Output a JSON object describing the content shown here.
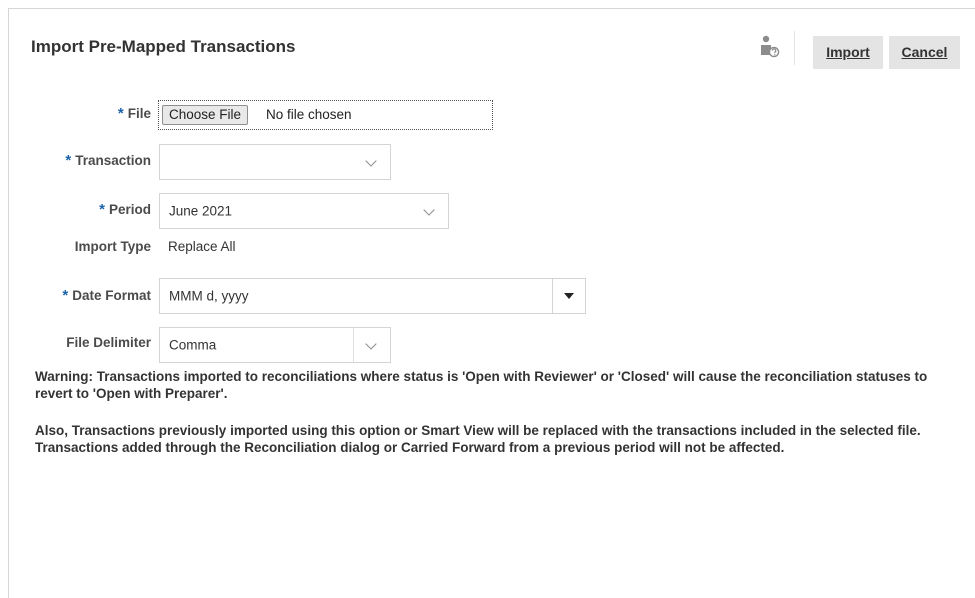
{
  "dialog": {
    "title": "Import Pre-Mapped Transactions",
    "help_icon": "user-help-icon",
    "import_label": "Import",
    "cancel_label": "Cancel"
  },
  "form": {
    "required_marker": "*",
    "file": {
      "label": "File",
      "button_label": "Choose File",
      "status": "No file chosen"
    },
    "transaction": {
      "label": "Transaction",
      "value": ""
    },
    "period": {
      "label": "Period",
      "value": "June 2021"
    },
    "import_type": {
      "label": "Import Type",
      "value": "Replace All"
    },
    "date_format": {
      "label": "Date Format",
      "value": "MMM d, yyyy"
    },
    "file_delimiter": {
      "label": "File Delimiter",
      "value": "Comma"
    }
  },
  "messages": {
    "warning": "Warning: Transactions imported to reconciliations where status is 'Open with Reviewer' or 'Closed' will cause the reconciliation statuses to revert to 'Open with Preparer'.",
    "note": "Also, Transactions previously imported using this option or Smart View will be replaced with the transactions included in the selected file. Transactions added through the Reconciliation dialog or Carried Forward from a previous period will not be affected."
  },
  "colors": {
    "required": "#1b63a9",
    "button_bg": "#e4e4e4"
  }
}
